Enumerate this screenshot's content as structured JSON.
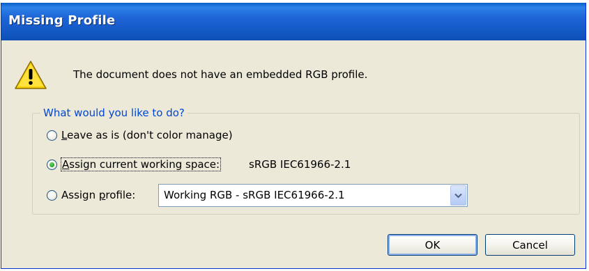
{
  "window": {
    "title": "Missing Profile"
  },
  "message": {
    "icon": "warning-icon",
    "text": "The document does not have an embedded RGB profile."
  },
  "group": {
    "label": "What would you like to do?",
    "options": [
      {
        "label_first": "L",
        "label_rest": "eave as is (don't color manage)",
        "checked": false
      },
      {
        "label_first": "A",
        "label_rest": "ssign current working space:",
        "checked": true,
        "value": "sRGB IEC61966-2.1"
      },
      {
        "label_pre": "Assign ",
        "label_u": "p",
        "label_post": "rofile:",
        "checked": false
      }
    ],
    "profile_select": {
      "value": "Working RGB - sRGB IEC61966-2.1"
    }
  },
  "buttons": {
    "ok": "OK",
    "cancel": "Cancel"
  },
  "colors": {
    "title_bar": "#1e64d7",
    "group_label": "#0046d5",
    "dialog_bg": "#ece9d8"
  }
}
